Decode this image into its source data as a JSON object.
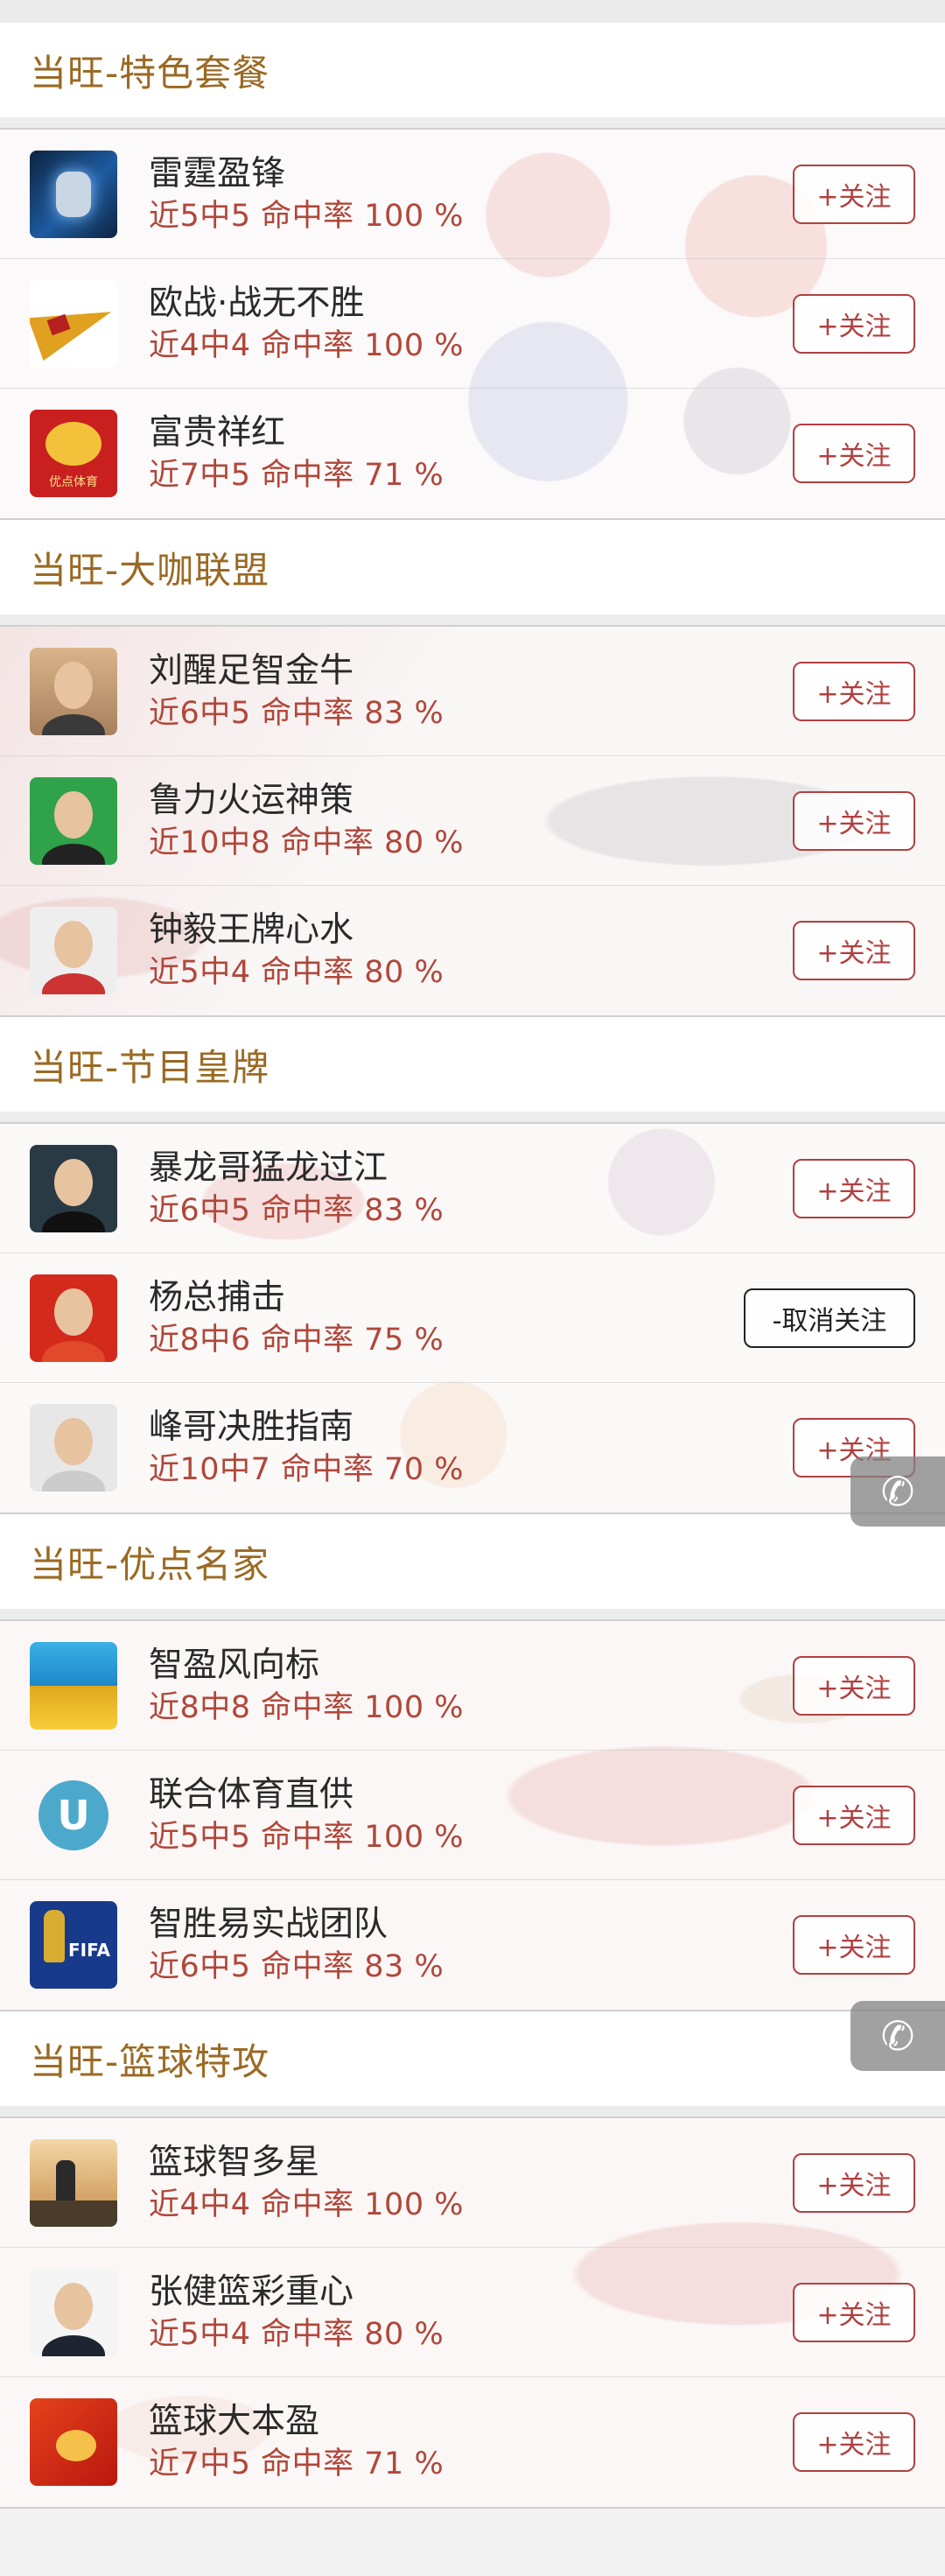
{
  "sections": [
    {
      "title": "当旺-特色套餐",
      "items": [
        {
          "name": "雷霆盈锋",
          "stats": "近5中5 命中率 100 %",
          "button": "+关注",
          "followed": false,
          "avatar": "fist-icon"
        },
        {
          "name": "欧战·战无不胜",
          "stats": "近4中4 命中率 100 %",
          "button": "+关注",
          "followed": false,
          "avatar": "pennant-icon"
        },
        {
          "name": "富贵祥红",
          "stats": "近7中5 命中率 71 %",
          "button": "+关注",
          "followed": false,
          "avatar": "pig-logo-icon"
        }
      ]
    },
    {
      "title": "当旺-大咖联盟",
      "items": [
        {
          "name": "刘醒足智金牛",
          "stats": "近6中5 命中率 83 %",
          "button": "+关注",
          "followed": false,
          "avatar": "user-avatar"
        },
        {
          "name": "鲁力火运神策",
          "stats": "近10中8 命中率 80 %",
          "button": "+关注",
          "followed": false,
          "avatar": "user-avatar"
        },
        {
          "name": "钟毅王牌心水",
          "stats": "近5中4 命中率 80 %",
          "button": "+关注",
          "followed": false,
          "avatar": "user-avatar"
        }
      ]
    },
    {
      "title": "当旺-节目皇牌",
      "items": [
        {
          "name": "暴龙哥猛龙过江",
          "stats": "近6中5 命中率 83 %",
          "button": "+关注",
          "followed": false,
          "avatar": "user-avatar"
        },
        {
          "name": "杨总捕击",
          "stats": "近8中6 命中率 75 %",
          "button": "-取消关注",
          "followed": true,
          "avatar": "user-avatar"
        },
        {
          "name": "峰哥决胜指南",
          "stats": "近10中7 命中率 70 %",
          "button": "+关注",
          "followed": false,
          "avatar": "user-avatar"
        }
      ]
    },
    {
      "title": "当旺-优点名家",
      "items": [
        {
          "name": "智盈风向标",
          "stats": "近8中8 命中率 100 %",
          "button": "+关注",
          "followed": false,
          "avatar": "gold-ingot-icon"
        },
        {
          "name": "联合体育直供",
          "stats": "近5中5 命中率 100 %",
          "button": "+关注",
          "followed": false,
          "avatar": "u-logo-icon"
        },
        {
          "name": "智胜易实战团队",
          "stats": "近6中5 命中率 83 %",
          "button": "+关注",
          "followed": false,
          "avatar": "fifa-trophy-icon"
        }
      ]
    },
    {
      "title": "当旺-篮球特攻",
      "items": [
        {
          "name": "篮球智多星",
          "stats": "近4中4 命中率 100 %",
          "button": "+关注",
          "followed": false,
          "avatar": "city-skyline-icon"
        },
        {
          "name": "张健篮彩重心",
          "stats": "近5中4 命中率 80 %",
          "button": "+关注",
          "followed": false,
          "avatar": "user-avatar"
        },
        {
          "name": "篮球大本盈",
          "stats": "近7中5 命中率 71 %",
          "button": "+关注",
          "followed": false,
          "avatar": "red-logo-icon"
        }
      ]
    }
  ],
  "float_button": {
    "icon": "phone-icon"
  },
  "colors": {
    "section_title": "#9a6a23",
    "stats": "#b0473a",
    "follow_border": "#b04040"
  }
}
